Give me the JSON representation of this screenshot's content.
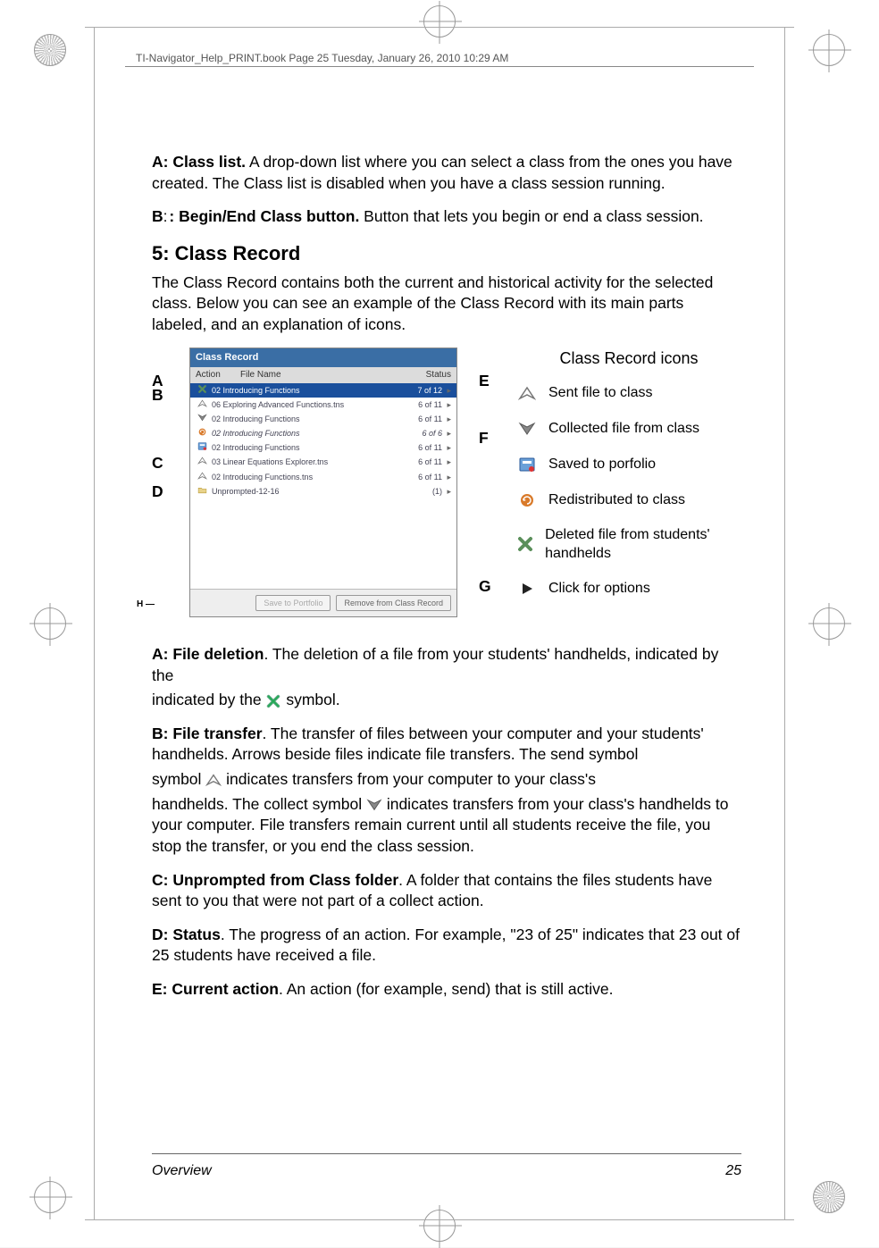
{
  "header": {
    "bookline": "TI-Navigator_Help_PRINT.book  Page 25  Tuesday, January 26, 2010  10:29 AM"
  },
  "para_a": {
    "label": "A: Class list.",
    "text": " A drop-down list where you can select a class from the ones you have created. The Class list is disabled when you have a class session running."
  },
  "para_b": {
    "label_pre": "B",
    "label_post": ": Begin/End Class button.",
    "text": " Button that lets you begin or end a class session."
  },
  "section5": {
    "heading": "5: Class Record",
    "intro": "The Class Record contains both the current and historical activity for the selected class. Below you can see an example of the Class Record with its main parts labeled, and an explanation of icons."
  },
  "class_record": {
    "title": "Class Record",
    "cols": {
      "action": "Action",
      "file": "File Name",
      "status": "Status"
    },
    "rows": [
      {
        "icon": "delete",
        "file": "02 Introducing Functions",
        "status": "7 of 12",
        "sel": true,
        "italic": false
      },
      {
        "icon": "send",
        "file": "06 Exploring Advanced Functions.tns",
        "status": "6 of 11",
        "sel": false,
        "italic": false
      },
      {
        "icon": "collect",
        "file": "02 Introducing Functions",
        "status": "6 of 11",
        "sel": false,
        "italic": false
      },
      {
        "icon": "redist",
        "file": "02 Introducing Functions",
        "status": "6 of 6",
        "sel": false,
        "italic": true
      },
      {
        "icon": "save",
        "file": "02 Introducing Functions",
        "status": "6 of 11",
        "sel": false,
        "italic": false
      },
      {
        "icon": "send",
        "file": "03 Linear Equations Explorer.tns",
        "status": "6 of 11",
        "sel": false,
        "italic": false
      },
      {
        "icon": "send",
        "file": "02 Introducing Functions.tns",
        "status": "6 of 11",
        "sel": false,
        "italic": false
      },
      {
        "icon": "folder",
        "file": "Unprompted-12-16",
        "status": "(1)",
        "sel": false,
        "italic": false
      }
    ],
    "buttons": {
      "save": "Save to Portfolio",
      "remove": "Remove from Class Record"
    }
  },
  "labels": {
    "A": "A",
    "B": "B",
    "C": "C",
    "D": "D",
    "E": "E",
    "F": "F",
    "G": "G",
    "H": "H"
  },
  "legend": {
    "title": "Class Record icons",
    "items": [
      {
        "key": "send",
        "text": "Sent file to class"
      },
      {
        "key": "collect",
        "text": "Collected file from class"
      },
      {
        "key": "save",
        "text": "Saved to porfolio"
      },
      {
        "key": "redist",
        "text": "Redistributed to class"
      },
      {
        "key": "delete",
        "text": "Deleted file from students' handhelds"
      },
      {
        "key": "options",
        "text": "Click for options"
      }
    ]
  },
  "defs": {
    "a": {
      "label": "A: File deletion",
      "text1": ". The deletion of a file from your students' handhelds, indicated by the ",
      "text2": " symbol."
    },
    "b": {
      "label": "B: File transfer",
      "text1": ". The transfer of files between your computer and your students' handhelds. Arrows beside files indicate file transfers. The send symbol ",
      "text2": " indicates transfers from your computer to your class's handhelds. The collect symbol ",
      "text3": " indicates transfers from your class's handhelds to your computer. File transfers remain current until all students receive the file, you stop the transfer, or you end the class session."
    },
    "c": {
      "label": "C: Unprompted from Class folder",
      "text": ". A folder that contains the files students have sent to you that were not part of a collect action."
    },
    "d": {
      "label": "D: Status",
      "text": ". The progress of an action. For example, \"23 of 25\" indicates that 23 out of 25 students have received a file."
    },
    "e": {
      "label": "E: Current action",
      "text": ". An action (for example, send) that is still active."
    }
  },
  "footer": {
    "section": "Overview",
    "page": "25"
  }
}
